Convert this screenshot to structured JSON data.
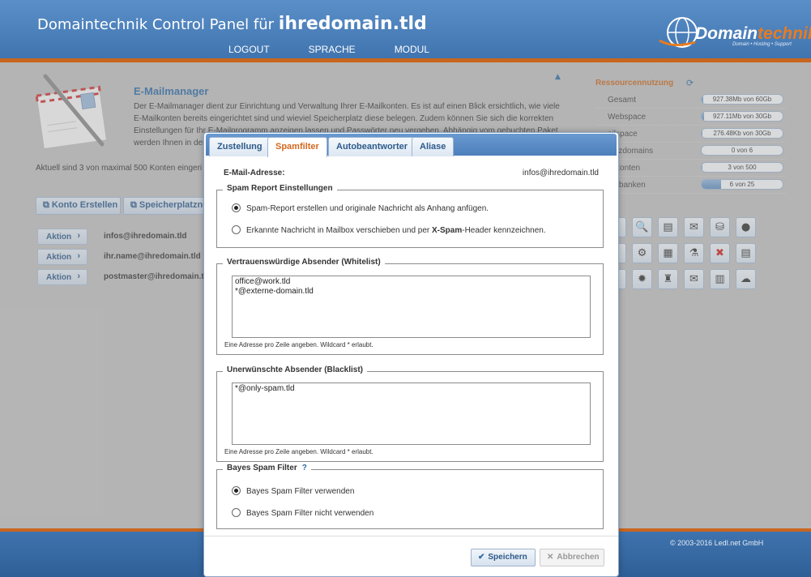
{
  "header": {
    "title_prefix": "Domaintechnik Control Panel für",
    "title_domain": "ihredomain.tld",
    "nav": [
      "LOGOUT",
      "SPRACHE",
      "MODUL"
    ],
    "logo_main": "Domain",
    "logo_accent": "technik",
    "logo_tagline": "Domain • Hosting • Support"
  },
  "module": {
    "title": "E-Mailmanager",
    "description": "Der E-Mailmanager dient zur Einrichtung und Verwaltung Ihrer E-Mailkonten. Es ist auf einen Blick ersichtlich, wie viele E-Mailkonten bereits eingerichtet sind und wieviel Speicherplatz diese belegen. Zudem können Sie sich die korrekten Einstellungen für Ihr E-Mailprogramm anzeigen lassen und Passwörter neu vergeben. Abhängig vom gebuchten Paket werden Ihnen in der",
    "accounts_info": "Aktuell sind 3 von maximal 500 Konten eingeri",
    "btn_create": "Konto Erstellen",
    "btn_storage": "Speicherplatznu",
    "accounts": [
      {
        "action": "Aktion",
        "email": "infos@ihredomain.tld"
      },
      {
        "action": "Aktion",
        "email": "ihr.name@ihredomain.tld"
      },
      {
        "action": "Aktion",
        "email": "postmaster@ihredomain.tld"
      }
    ]
  },
  "resources": {
    "title": "Ressourcennutzung",
    "rows": [
      {
        "label": "Gesamt",
        "value": "927.38Mb von 60Gb",
        "fill": 0.02
      },
      {
        "label": "Webspace",
        "value": "927.11Mb von 30Gb",
        "fill": 0.03
      },
      {
        "label": "ailspace",
        "value": "276.48Kb von 30Gb",
        "fill": 0.01
      },
      {
        "label": "satzdomains",
        "value": "0 von 6",
        "fill": 0.0
      },
      {
        "label": "ailkonten",
        "value": "3 von 500",
        "fill": 0.01
      },
      {
        "label": "tenbanken",
        "value": "6 von 25",
        "fill": 0.24
      }
    ]
  },
  "footer": {
    "copyright": "© 2003-2016 Ledl.net GmbH"
  },
  "modal": {
    "tabs": [
      "Zustellung",
      "Spamfilter",
      "Autobeantworter",
      "Aliase"
    ],
    "active_tab": "Spamfilter",
    "email_label": "E-Mail-Adresse:",
    "email_value": "infos@ihredomain.tld",
    "spam_report": {
      "legend": "Spam Report Einstellungen",
      "option1": "Spam-Report erstellen und originale Nachricht als Anhang anfügen.",
      "option2_pre": "Erkannte Nachricht in Mailbox verschieben und per ",
      "option2_bold": "X-Spam",
      "option2_post": "-Header kennzeichnen.",
      "selected": 1
    },
    "whitelist": {
      "legend": "Vertrauenswürdige Absender (Whitelist)",
      "value": "office@work.tld\n*@externe-domain.tld",
      "hint": "Eine Adresse pro Zeile angeben. Wildcard * erlaubt."
    },
    "blacklist": {
      "legend": "Unerwünschte Absender (Blacklist)",
      "value": "*@only-spam.tld",
      "hint": "Eine Adresse pro Zeile angeben. Wildcard * erlaubt."
    },
    "bayes": {
      "legend": "Bayes Spam Filter",
      "help": "?",
      "option1": "Bayes Spam Filter verwenden",
      "option2": "Bayes Spam Filter nicht verwenden",
      "selected": 1
    },
    "save_label": "Speichern",
    "cancel_label": "Abbrechen"
  },
  "colors": {
    "accent": "#c9661e",
    "brand_blue": "#3f73ae",
    "active_tab": "#d2691e"
  }
}
